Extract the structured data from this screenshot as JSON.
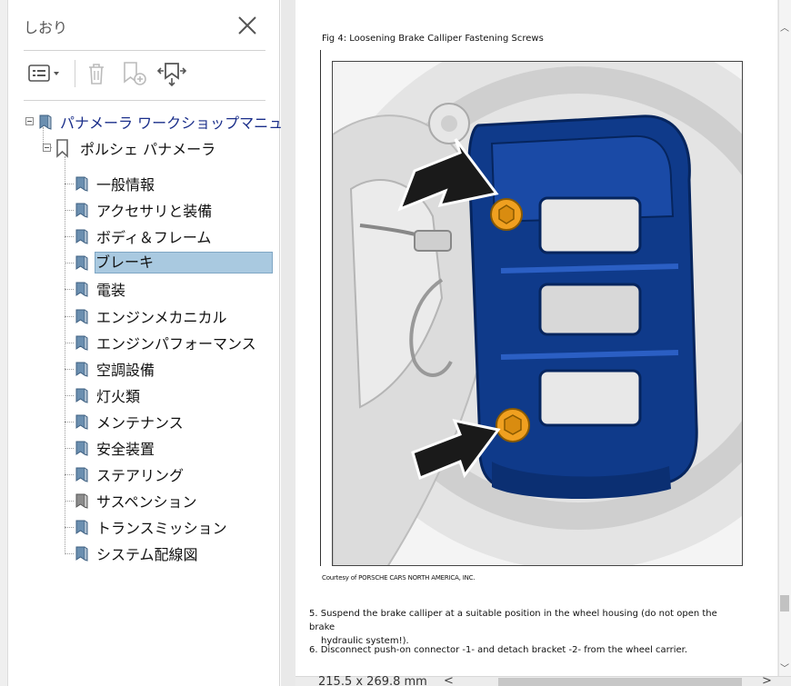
{
  "panel": {
    "title": "しおり"
  },
  "bookmarks": {
    "root": "パナメーラ ワークショップマニュアル",
    "child": "ポルシェ パナメーラ",
    "items": [
      "一般情報",
      "アクセサリと装備",
      "ボディ＆フレーム",
      "ブレーキ",
      "電装",
      "エンジンメカニカル",
      "エンジンパフォーマンス",
      "空調設備",
      "灯火類",
      "メンテナンス",
      "安全装置",
      "ステアリング",
      "サスペンション",
      "トランスミッション",
      "システム配線図"
    ],
    "selected_index": 3
  },
  "document": {
    "fig_caption": "Fig 4: Loosening Brake Calliper Fastening Screws",
    "courtesy": "Courtesy of PORSCHE CARS NORTH AMERICA, INC.",
    "step5_line1": "5. Suspend the brake calliper at a suitable position in the wheel housing (do not open the brake",
    "step5_line2": "hydraulic system!).",
    "step6": "6. Disconnect push-on connector -1-  and detach bracket -2-  from the wheel carrier.",
    "page_size": "215.5 x 269.8 mm"
  },
  "colors": {
    "selection": "#a9c9e0",
    "caliper": "#0f3a8a",
    "bolt": "#f0a020"
  }
}
